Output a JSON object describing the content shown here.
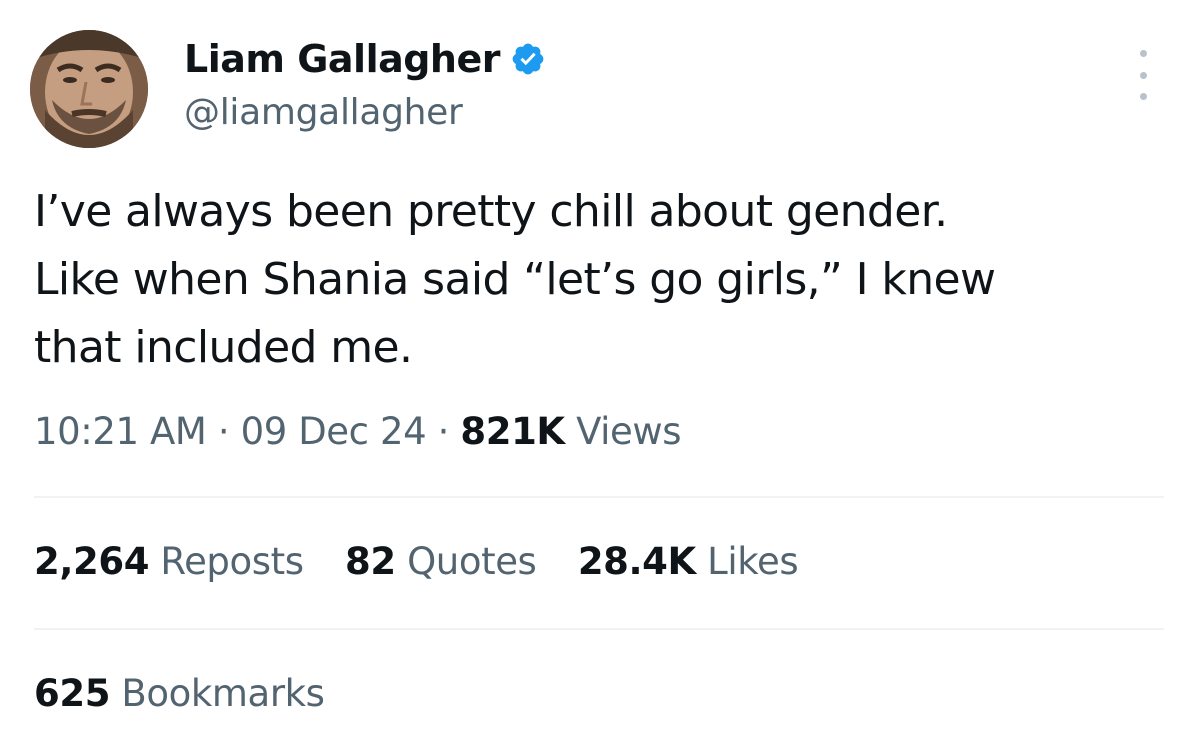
{
  "author": {
    "display_name": "Liam Gallagher",
    "handle": "@liamgallagher",
    "verified": true,
    "verified_color": "#1d9bf0"
  },
  "tweet": {
    "lines": [
      "I’ve always been pretty chill about gender.",
      "Like when Shania said “let’s go girls,” I knew",
      "that included me."
    ]
  },
  "meta": {
    "time": "10:21 AM",
    "separator": "·",
    "date": "09 Dec 24",
    "views_count": "821K",
    "views_label": "Views"
  },
  "stats": {
    "reposts_count": "2,264",
    "reposts_label": "Reposts",
    "quotes_count": "82",
    "quotes_label": "Quotes",
    "likes_count": "28.4K",
    "likes_label": "Likes",
    "bookmarks_count": "625",
    "bookmarks_label": "Bookmarks"
  },
  "icons": {
    "verified": "verified-badge-icon",
    "more": "more-options-icon"
  }
}
